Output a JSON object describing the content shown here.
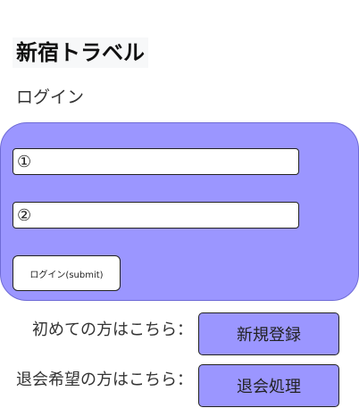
{
  "header": {
    "title": "新宿トラベル",
    "subtitle": "ログイン"
  },
  "login_form": {
    "field_1_placeholder": "①",
    "field_2_placeholder": "②",
    "field_1_value": "",
    "field_2_value": "",
    "submit_label": "ログイン(submit)"
  },
  "links": {
    "register_prompt": "初めての方はこちら：",
    "register_button": "新規登録",
    "withdraw_prompt": "退会希望の方はこちら：",
    "withdraw_button": "退会処理"
  },
  "colors": {
    "panel": "#9b96ff",
    "button": "#9b96ff",
    "title_background": "#f7f8f9"
  }
}
